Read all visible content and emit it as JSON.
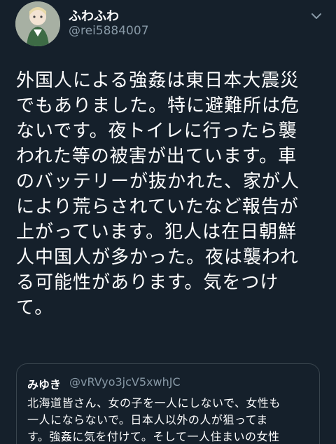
{
  "author": {
    "display_name": "ふわふわ",
    "handle": "@rei5884007",
    "avatar_icon": "anime-character-avatar-icon",
    "menu_icon": "chevron-down-icon"
  },
  "tweet": {
    "lines": [
      "外国人による強姦は東日本大震災",
      "でもありました。特に避難所は危",
      "ないです。夜トイレに行ったら襲",
      "われた等の被害が出ています。車",
      "のバッテリーが抜かれた、家が人",
      "により荒らされていたなど報告が",
      "上がっています。犯人は在日朝鮮",
      "人中国人が多かった。夜は襲われ",
      "る可能性があります。気をつけ",
      "て。"
    ]
  },
  "quoted_tweet": {
    "display_name": "みゆき",
    "handle": "@vRVyo3jcV5xwhJC",
    "lines": [
      "北海道皆さん、女の子を一人にしないで、女性も",
      "一人にならないで。日本人以外の人が狙ってま",
      "す。強姦に気を付けて。そして一人住まいの女性"
    ]
  },
  "colors": {
    "background": "#15202b",
    "text": "#ffffff",
    "secondary_text": "#8899a6",
    "border": "#38444d"
  }
}
